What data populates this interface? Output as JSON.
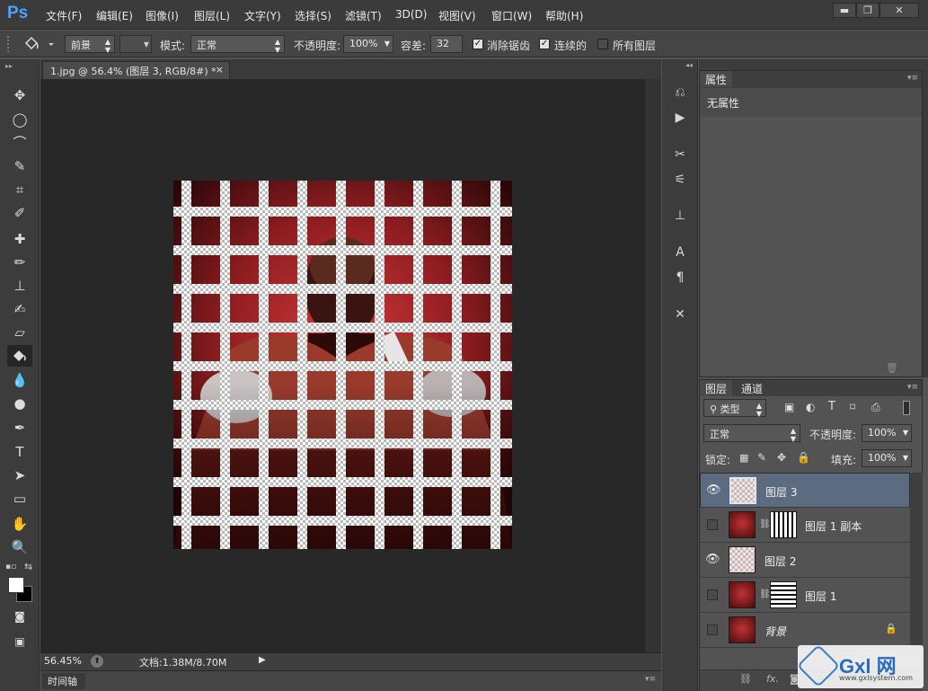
{
  "app": {
    "logo": "Ps"
  },
  "menu": [
    "文件(F)",
    "编辑(E)",
    "图像(I)",
    "图层(L)",
    "文字(Y)",
    "选择(S)",
    "滤镜(T)",
    "3D(D)",
    "视图(V)",
    "窗口(W)",
    "帮助(H)"
  ],
  "window_controls": {
    "minimize": "▬",
    "restore": "❐",
    "close": "✕"
  },
  "options": {
    "fill_source": "前景",
    "mode_label": "模式:",
    "mode_value": "正常",
    "opacity_label": "不透明度:",
    "opacity_value": "100%",
    "tolerance_label": "容差:",
    "tolerance_value": "32",
    "antialias_label": "消除锯齿",
    "antialias_checked": true,
    "contiguous_label": "连续的",
    "contiguous_checked": true,
    "all_layers_label": "所有图层",
    "all_layers_checked": false
  },
  "document": {
    "tab_title": "1.jpg @ 56.4% (图层 3, RGB/8#) *",
    "close": "×"
  },
  "status": {
    "zoom": "56.45%",
    "doc_info": "文档:1.38M/8.70M"
  },
  "timeline": {
    "label": "时间轴"
  },
  "properties": {
    "title": "属性",
    "content": "无属性"
  },
  "layers_panel": {
    "tabs": [
      "图层",
      "通道"
    ],
    "filter_kind": "类型",
    "blend_mode": "正常",
    "opacity_label": "不透明度:",
    "opacity_value": "100%",
    "lock_label": "锁定:",
    "fill_label": "填充:",
    "fill_value": "100%",
    "layers": [
      {
        "name": "图层 3",
        "visible": true,
        "selected": true,
        "thumb": "checker",
        "mask": false
      },
      {
        "name": "图层 1 副本",
        "visible": false,
        "selected": false,
        "thumb": "photo",
        "mask": "vertical"
      },
      {
        "name": "图层 2",
        "visible": true,
        "selected": false,
        "thumb": "checker",
        "mask": false
      },
      {
        "name": "图层 1",
        "visible": false,
        "selected": false,
        "thumb": "photo",
        "mask": "horizontal"
      },
      {
        "name": "背景",
        "visible": false,
        "selected": false,
        "thumb": "photo",
        "mask": false,
        "locked": true
      }
    ],
    "footer_icons": [
      "link-icon",
      "fx-icon",
      "mask-icon"
    ]
  },
  "watermark": {
    "text": "Gxl 网",
    "sub": "www.gxlsystem.com"
  }
}
